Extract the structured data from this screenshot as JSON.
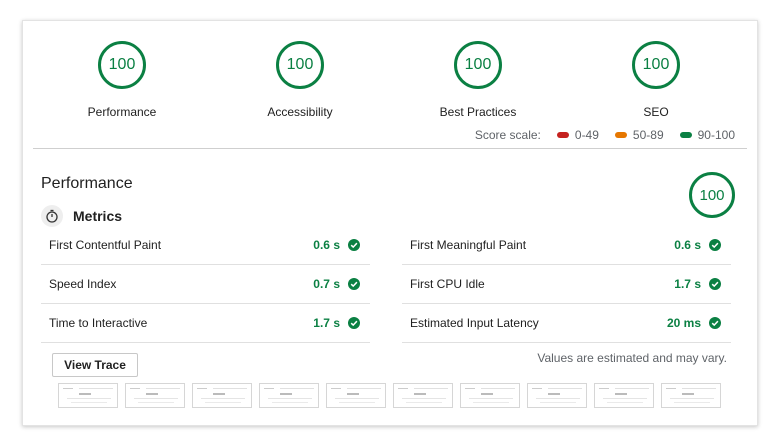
{
  "gauges": [
    {
      "score": "100",
      "label": "Performance"
    },
    {
      "score": "100",
      "label": "Accessibility"
    },
    {
      "score": "100",
      "label": "Best Practices"
    },
    {
      "score": "100",
      "label": "SEO"
    }
  ],
  "score_scale": {
    "label": "Score scale:",
    "ranges": [
      {
        "text": "0-49",
        "color": "#c5221f"
      },
      {
        "text": "50-89",
        "color": "#e67700"
      },
      {
        "text": "90-100",
        "color": "#0b8043"
      }
    ]
  },
  "performance": {
    "title": "Performance",
    "score": "100",
    "metrics_title": "Metrics",
    "metrics_left": [
      {
        "name": "First Contentful Paint",
        "value": "0.6 s"
      },
      {
        "name": "Speed Index",
        "value": "0.7 s"
      },
      {
        "name": "Time to Interactive",
        "value": "1.7 s"
      }
    ],
    "metrics_right": [
      {
        "name": "First Meaningful Paint",
        "value": "0.6 s"
      },
      {
        "name": "First CPU Idle",
        "value": "1.7 s"
      },
      {
        "name": "Estimated Input Latency",
        "value": "20 ms"
      }
    ],
    "view_trace_label": "View Trace",
    "disclaimer": "Values are estimated and may vary.",
    "filmstrip_frames": 10
  },
  "colors": {
    "pass": "#0b8043",
    "average": "#e67700",
    "fail": "#c5221f"
  },
  "icons": {
    "metrics": "stopwatch-icon",
    "pass": "check-circle-icon"
  }
}
